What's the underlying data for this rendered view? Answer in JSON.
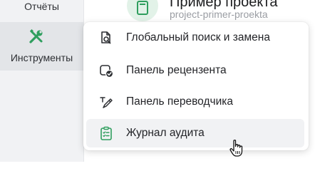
{
  "sidebar": {
    "reports_label": "Отчёты",
    "tools_label": "Инструменты"
  },
  "project": {
    "title": "Пример проекта",
    "slug": "project-primer-proekta"
  },
  "menu": {
    "items": [
      {
        "label": "Глобальный поиск и замена",
        "icon": "search-document-icon"
      },
      {
        "label": "Панель рецензента",
        "icon": "reviewer-panel-icon"
      },
      {
        "label": "Панель переводчика",
        "icon": "translator-pen-icon"
      },
      {
        "label": "Журнал аудита",
        "icon": "clipboard-checklist-icon",
        "highlighted": true
      }
    ]
  },
  "colors": {
    "accent_green": "#2f9e5e",
    "sidebar_bg": "#f1f2f4",
    "selected_sidebar_bg": "#e3e5e8",
    "menu_hover_bg": "#f1f2f4"
  }
}
